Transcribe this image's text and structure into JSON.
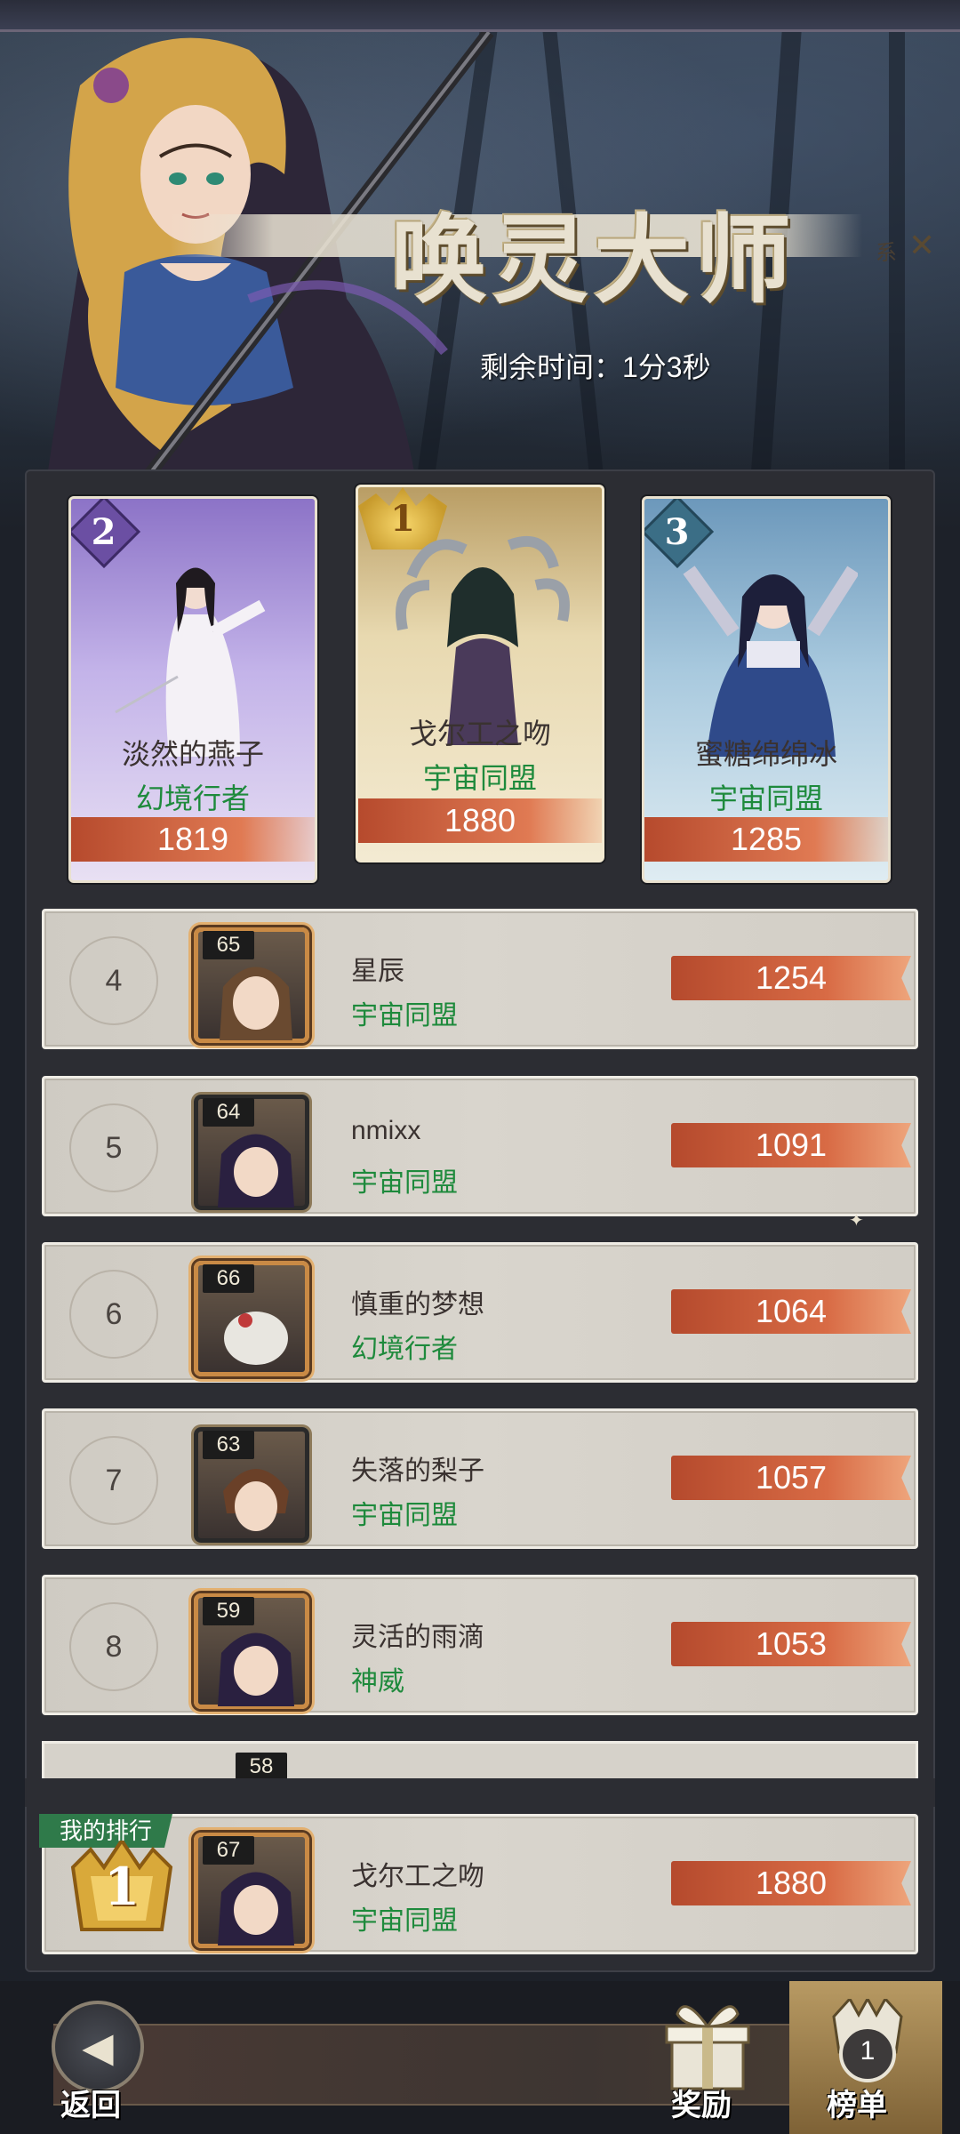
{
  "event": {
    "title": "唤灵大师",
    "title_badge": "系",
    "close_glyph": "✕",
    "timer": "剩余时间：1分3秒"
  },
  "podium": [
    {
      "rank": "2",
      "name": "淡然的燕子",
      "guild": "幻境行者",
      "score": "1819",
      "color": "#8c73c7"
    },
    {
      "rank": "1",
      "name": "戈尔工之吻",
      "guild": "宇宙同盟",
      "score": "1880",
      "color": "#e8d9b0"
    },
    {
      "rank": "3",
      "name": "蜜糖绵绵冰",
      "guild": "宇宙同盟",
      "score": "1285",
      "color": "#6c98bb"
    }
  ],
  "rows": [
    {
      "rank": "4",
      "level": "65",
      "name": "星辰",
      "guild": "宇宙同盟",
      "score": "1254"
    },
    {
      "rank": "5",
      "level": "64",
      "name": "nmixx",
      "guild": "宇宙同盟",
      "score": "1091"
    },
    {
      "rank": "6",
      "level": "66",
      "name": "慎重的梦想",
      "guild": "幻境行者",
      "score": "1064"
    },
    {
      "rank": "7",
      "level": "63",
      "name": "失落的梨子",
      "guild": "宇宙同盟",
      "score": "1057"
    },
    {
      "rank": "8",
      "level": "59",
      "name": "灵活的雨滴",
      "guild": "神威",
      "score": "1053"
    }
  ],
  "partial_row": {
    "level": "58"
  },
  "my_rank": {
    "tag": "我的排行",
    "rank": "1",
    "level": "67",
    "name": "戈尔工之吻",
    "guild": "宇宙同盟",
    "score": "1880"
  },
  "bottom_bar": {
    "back_label": "返回",
    "reward_label": "奖励",
    "leaderboard_label": "榜单",
    "leaderboard_badge": "1"
  },
  "colors": {
    "guild_green": "#1e8a3c",
    "score_bar": "#c85a38",
    "row_bg": "#d6d2ca",
    "board_bg": "#2c2d33"
  }
}
